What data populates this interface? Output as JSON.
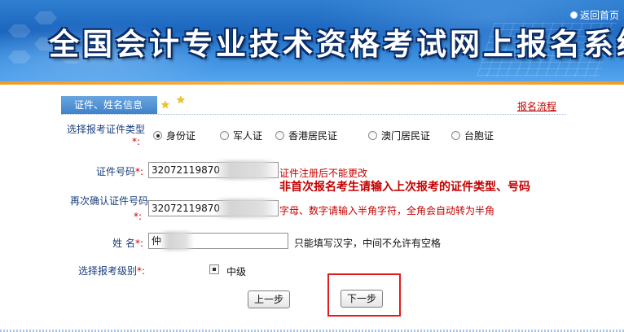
{
  "header": {
    "title": "全国会计专业技术资格考试网上报名系统",
    "return_link": "返回首页"
  },
  "section": {
    "tab_label": "证件、姓名信息",
    "flow_link": "报名流程"
  },
  "form": {
    "id_type": {
      "label": "选择报考证件类型",
      "required_mark": "*:",
      "options": [
        "身份证",
        "军人证",
        "香港居民证",
        "澳门居民证",
        "台胞证"
      ],
      "selected_index": 0
    },
    "id_number": {
      "label": "证件号码",
      "required_mark": "*:",
      "value": "32072119870",
      "hint": "证件注册后不能更改",
      "notice": "非首次报名考生请输入上次报考的证件类型、号码"
    },
    "confirm_id": {
      "label": "再次确认证件号码",
      "required_mark": "*:",
      "value": "32072119870",
      "hint": "字母、数字请输入半角字符，全角会自动转为半角"
    },
    "name": {
      "label": "姓 名",
      "required_mark": "*:",
      "value": "仲",
      "hint": "只能填写汉字，中间不允许有空格"
    },
    "level": {
      "label": "选择报考级别",
      "required_mark": "*:",
      "option": "中级",
      "checked": true
    }
  },
  "buttons": {
    "prev": "上一步",
    "next": "下一步"
  },
  "colors": {
    "banner_blue": "#1c66bf",
    "accent_orange": "#f39a24",
    "required_red": "#d00000",
    "label_blue": "#1a3e7e",
    "highlight_red": "#e21b1b"
  }
}
